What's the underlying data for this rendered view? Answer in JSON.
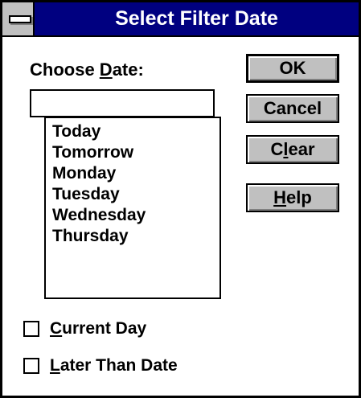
{
  "window": {
    "title": "Select Filter Date"
  },
  "date_picker": {
    "label_prefix": "Choose ",
    "label_mnemonic": "D",
    "label_suffix": "ate:",
    "input_value": "",
    "items": [
      "Today",
      "Tomorrow",
      "Monday",
      "Tuesday",
      "Wednesday",
      "Thursday"
    ]
  },
  "buttons": {
    "ok": "OK",
    "cancel": "Cancel",
    "clear_prefix": "C",
    "clear_mnemonic": "l",
    "clear_suffix": "ear",
    "help_mnemonic": "H",
    "help_suffix": "elp"
  },
  "options": {
    "current_day": {
      "mnemonic": "C",
      "suffix": "urrent Day",
      "checked": false
    },
    "later_than_date": {
      "mnemonic": "L",
      "suffix": "ater Than Date",
      "checked": false
    }
  },
  "colors": {
    "title_bar": "#000080",
    "button_face": "#c0c0c0"
  }
}
